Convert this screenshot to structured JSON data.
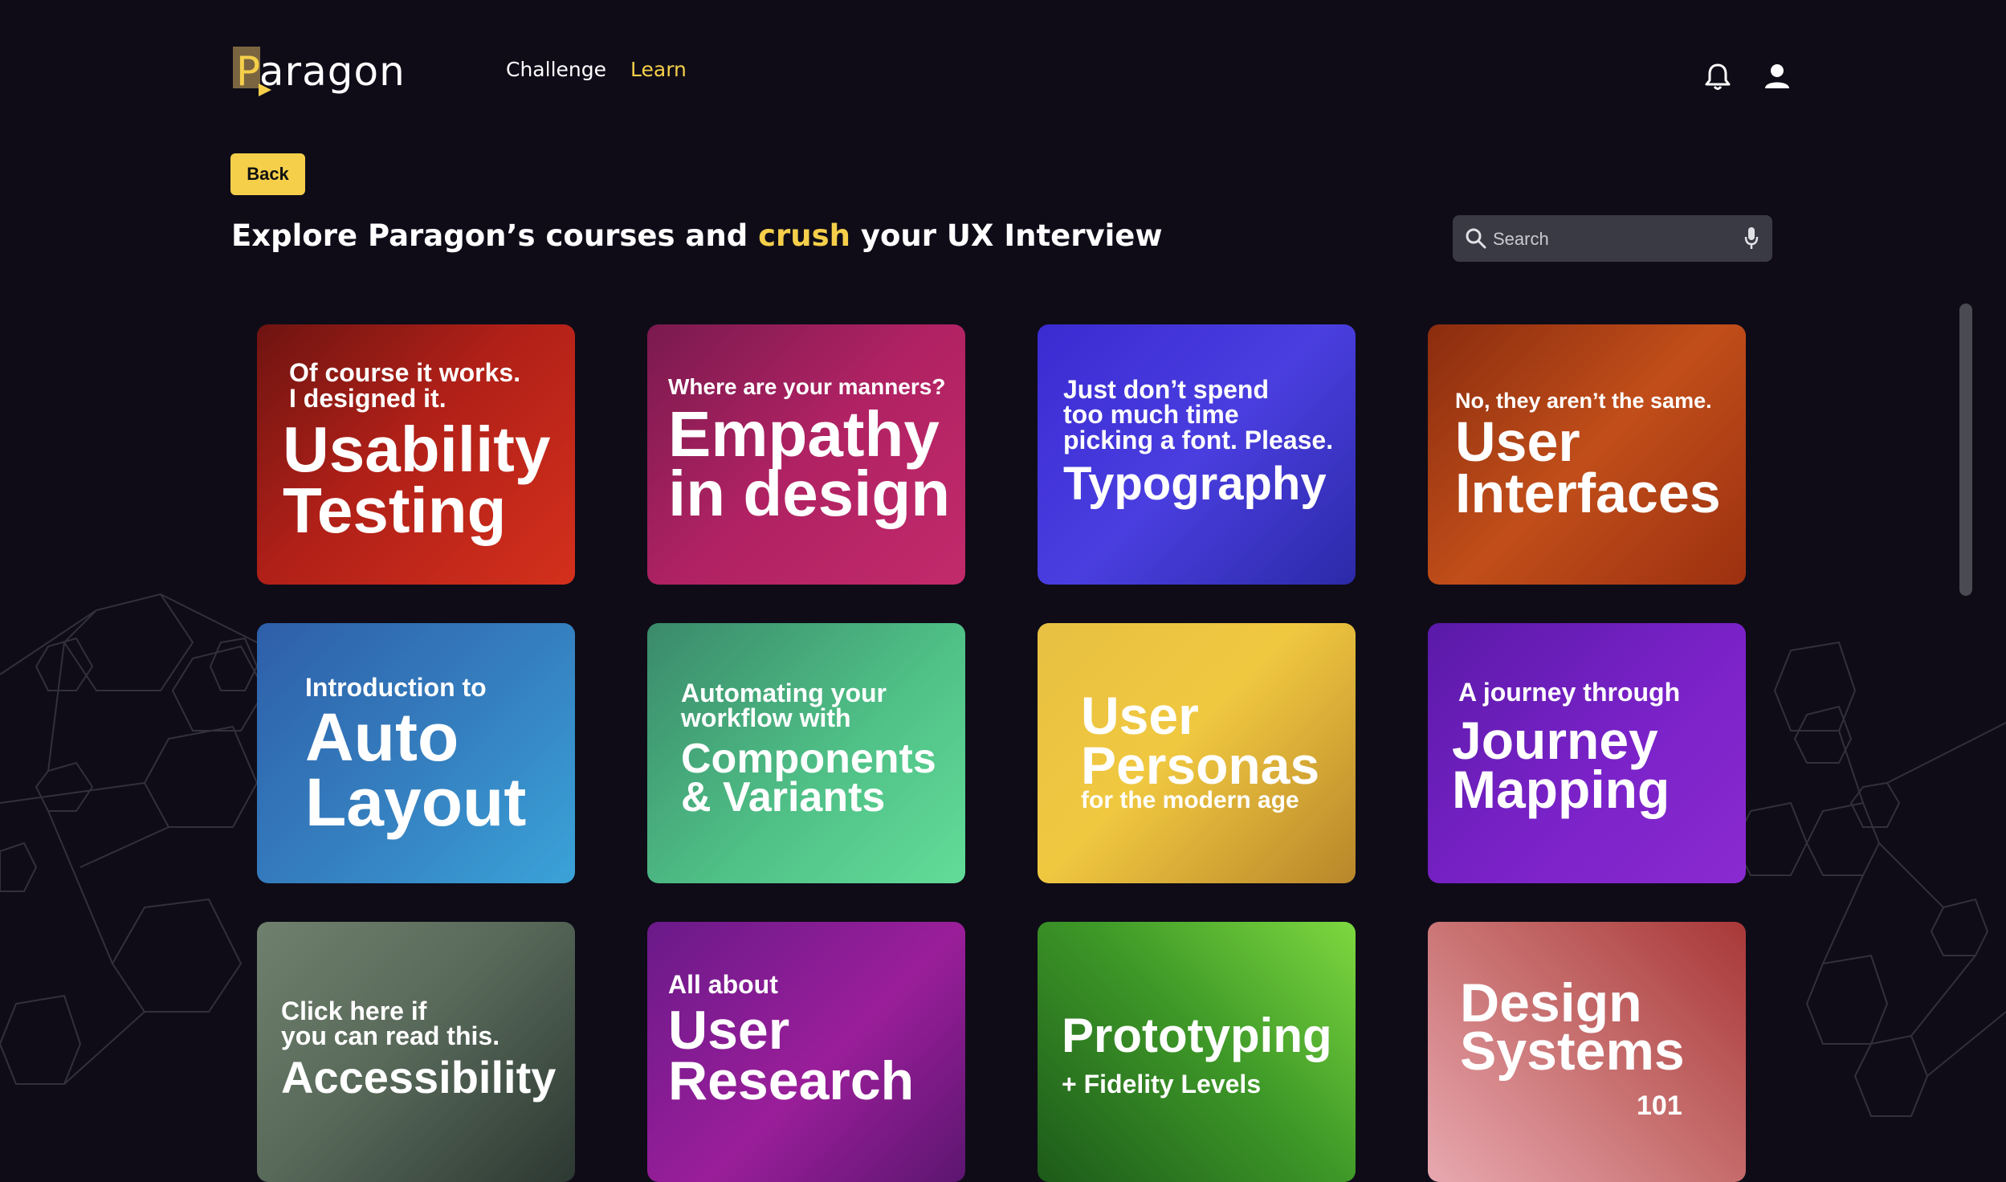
{
  "header": {
    "logo_text": "Paragon",
    "nav": [
      {
        "label": "Challenge"
      },
      {
        "label": "Learn"
      }
    ],
    "icons": [
      "bell-icon",
      "user-icon"
    ]
  },
  "back_label": "Back",
  "headline": {
    "before": "Explore Paragon’s courses and ",
    "highlight": "crush",
    "after": " your UX Interview"
  },
  "search": {
    "placeholder": "Search",
    "icons": [
      "search-icon",
      "mic-icon"
    ]
  },
  "colors": {
    "background": "#0f0c18",
    "accent": "#f5cf4a"
  },
  "courses": [
    {
      "sub": "Of course it works.\nI designed it.",
      "main": "Usability\nTesting"
    },
    {
      "sub": "Where are your manners?",
      "main": "Empathy\nin design"
    },
    {
      "sub": "Just don’t spend\ntoo much time\npicking a font. Please.",
      "main": "Typography"
    },
    {
      "sub": "No, they aren’t the same.",
      "main": "User\nInterfaces"
    },
    {
      "sub": "Introduction to",
      "main": "Auto\nLayout"
    },
    {
      "sub": "Automating your\nworkflow with",
      "main": "Components\n& Variants"
    },
    {
      "main": "User\nPersonas",
      "tail": "for the modern age"
    },
    {
      "sub": "A journey through",
      "main": "Journey\nMapping"
    },
    {
      "sub": "Click here if\nyou can read this.",
      "main": "Accessibility"
    },
    {
      "sub": "All about",
      "main": "User\nResearch"
    },
    {
      "main": "Prototyping",
      "tail": "+ Fidelity Levels"
    },
    {
      "main": "Design\nSystems",
      "tail": "101"
    }
  ]
}
